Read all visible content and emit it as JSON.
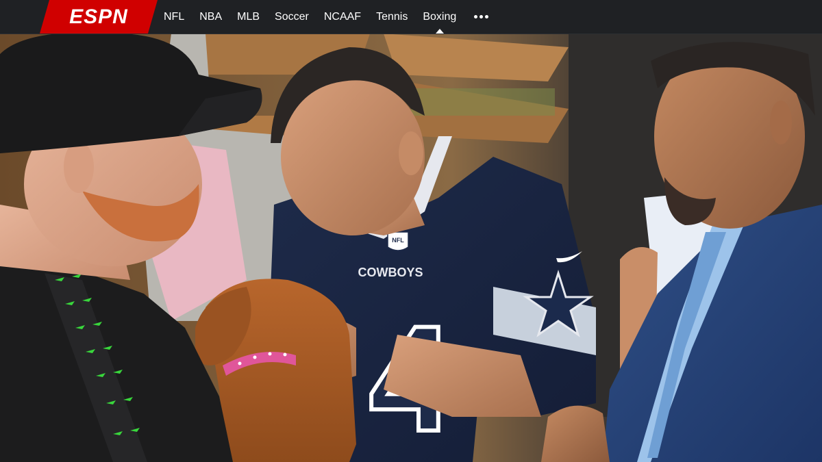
{
  "brand": {
    "logo_text": "ESPN",
    "logo_color": "#d00000",
    "nav_background": "#1f2124"
  },
  "nav": {
    "items": [
      {
        "label": "NFL",
        "active": false
      },
      {
        "label": "NBA",
        "active": false
      },
      {
        "label": "MLB",
        "active": false
      },
      {
        "label": "Soccer",
        "active": false
      },
      {
        "label": "NCAAF",
        "active": false
      },
      {
        "label": "Tennis",
        "active": false
      },
      {
        "label": "Boxing",
        "active": true
      }
    ],
    "more_icon": "more-horizontal-icon"
  },
  "hero": {
    "jersey_number": "4",
    "jersey_text": "COWBOYS",
    "jersey_badge": "NFL"
  }
}
